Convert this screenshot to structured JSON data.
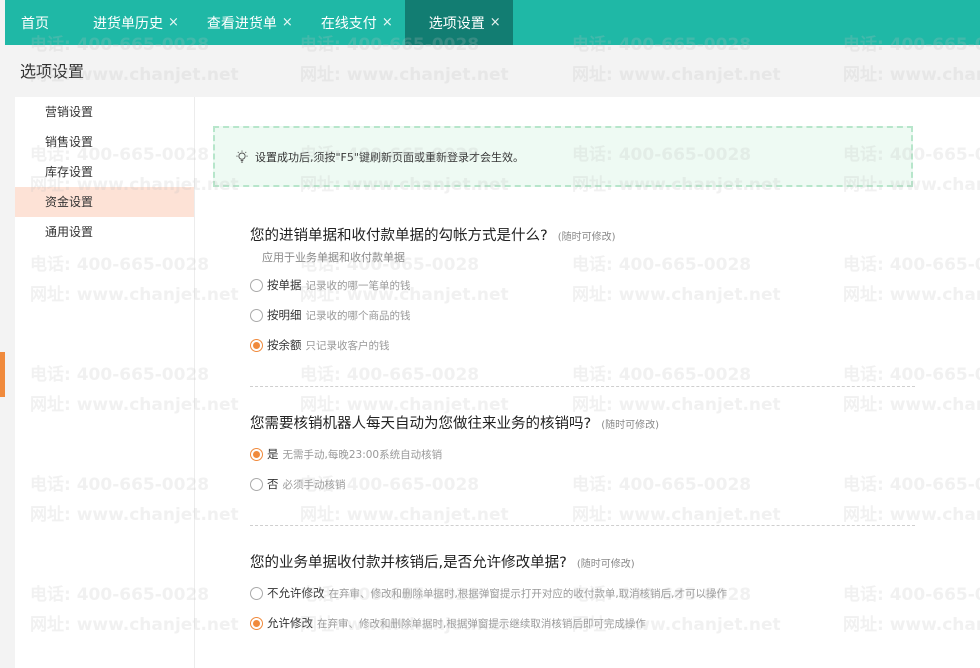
{
  "tabs": [
    {
      "label": "首页",
      "closable": false
    },
    {
      "label": "进货单历史",
      "closable": true
    },
    {
      "label": "查看进货单",
      "closable": true
    },
    {
      "label": "在线支付",
      "closable": true
    },
    {
      "label": "选项设置",
      "closable": true,
      "active": true
    }
  ],
  "close_glyph": "×",
  "page_title": "选项设置",
  "sidenav": [
    {
      "label": "营销设置"
    },
    {
      "label": "销售设置"
    },
    {
      "label": "库存设置"
    },
    {
      "label": "资金设置",
      "active": true
    },
    {
      "label": "通用设置"
    }
  ],
  "notice": "设置成功后,须按\"F5\"键刷新页面或重新登录才会生效。",
  "sections": [
    {
      "title": "您的进销单据和收付款单据的勾帐方式是什么?",
      "hint": "(随时可修改)",
      "subtitle": "应用于业务单据和收付款单据",
      "options": [
        {
          "label": "按单据",
          "desc": "记录收的哪一笔单的钱",
          "selected": false
        },
        {
          "label": "按明细",
          "desc": "记录收的哪个商品的钱",
          "selected": false
        },
        {
          "label": "按余额",
          "desc": "只记录收客户的钱",
          "selected": true
        }
      ]
    },
    {
      "title": "您需要核销机器人每天自动为您做往来业务的核销吗?",
      "hint": "(随时可修改)",
      "options": [
        {
          "label": "是",
          "desc": "无需手动,每晚23:00系统自动核销",
          "selected": true
        },
        {
          "label": "否",
          "desc": "必须手动核销",
          "selected": false
        }
      ]
    },
    {
      "title": "您的业务单据收付款并核销后,是否允许修改单据?",
      "hint": "(随时可修改)",
      "options": [
        {
          "label": "不允许修改",
          "desc": "在弃审、修改和删除单据时,根据弹窗提示打开对应的收付款单,取消核销后,才可以操作",
          "selected": false
        },
        {
          "label": "允许修改",
          "desc": "在弃审、修改和删除单据时,根据弹窗提示继续取消核销后即可完成操作",
          "selected": true
        }
      ]
    }
  ],
  "watermark": {
    "phone": "电话: 400-665-0028",
    "site": "网址: www.chanjet.net"
  },
  "colors": {
    "teal": "#1fb8a6",
    "teal_active": "#127d72",
    "orange": "#f08a3c",
    "nav_active": "#fde2d6"
  }
}
